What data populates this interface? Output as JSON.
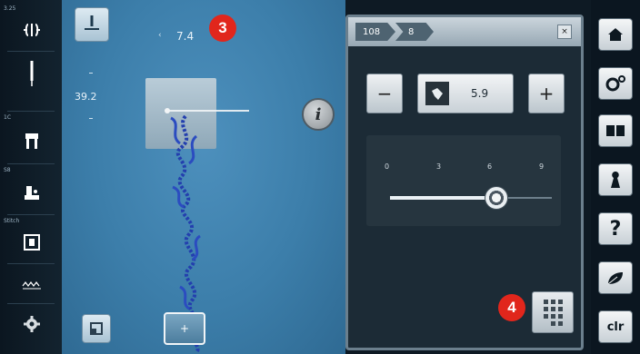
{
  "left_sidebar": {
    "items": [
      {
        "caption": "3.25",
        "icon": "stitch-width-icon"
      },
      {
        "caption": "",
        "icon": "needle-icon"
      },
      {
        "caption": "1C",
        "icon": "presser-foot-icon"
      },
      {
        "caption": "S8",
        "icon": "feed-dog-icon"
      },
      {
        "caption": "Stitch",
        "icon": "stitch-plate-icon"
      },
      {
        "caption": "",
        "icon": "thread-tension-icon"
      },
      {
        "caption": "",
        "icon": "settings-icon"
      }
    ]
  },
  "main": {
    "top_value": "7.4",
    "top_value_arrow": "‹",
    "side_value": "39.2",
    "callout_3": "3",
    "callout_4": "4"
  },
  "dialog": {
    "breadcrumb": [
      "108",
      "8"
    ],
    "close_label": "×",
    "minus_label": "−",
    "plus_label": "+",
    "value": "5.9",
    "slider": {
      "ticks": [
        "0",
        "3",
        "6",
        "9"
      ],
      "min": 0,
      "max": 9,
      "value": 5.9
    }
  },
  "right_sidebar": {
    "items": [
      {
        "icon": "home-icon"
      },
      {
        "icon": "setup-icon"
      },
      {
        "icon": "tutorial-icon"
      },
      {
        "icon": "creative-consultant-icon"
      },
      {
        "icon": "help-icon",
        "label": "?"
      },
      {
        "icon": "eco-icon"
      },
      {
        "icon": "clear-icon",
        "label": "clr"
      }
    ]
  },
  "colors": {
    "callout": "#e1261c",
    "main_blue": "#3c7eaa",
    "dialog_bg": "#1c2b36"
  }
}
